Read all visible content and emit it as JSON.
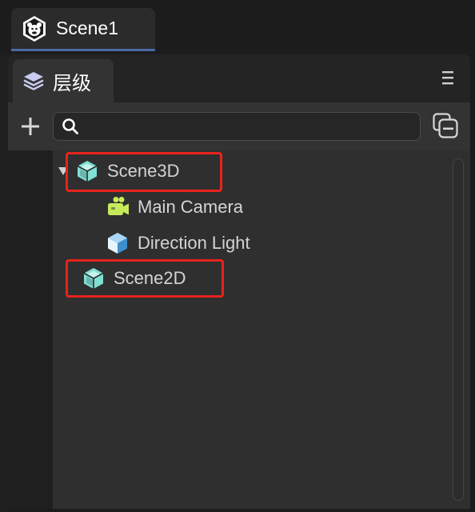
{
  "scene_tab": {
    "label": "Scene1",
    "icon": "monkey-logo-icon"
  },
  "panel": {
    "title": "层级",
    "icon": "layers-icon",
    "menu_icon": "menu-icon"
  },
  "toolbar": {
    "add_icon": "plus-icon",
    "search_icon": "search-icon",
    "search_placeholder": "",
    "search_value": "",
    "collapse_icon": "collapse-all-icon"
  },
  "tree": {
    "nodes": [
      {
        "label": "Scene3D",
        "icon": "cube-icon",
        "expanded": true,
        "highlighted": true
      },
      {
        "label": "Main Camera",
        "icon": "camera-icon",
        "highlighted": false
      },
      {
        "label": "Direction Light",
        "icon": "light-cube-icon",
        "highlighted": false
      },
      {
        "label": "Scene2D",
        "icon": "cube-icon",
        "highlighted": true
      }
    ]
  },
  "colors": {
    "accent": "#4a6aa8",
    "highlight": "#e8231c",
    "cube": "#7fe0d4",
    "camera": "#c6ea5a",
    "light": "#6cb4e8"
  }
}
